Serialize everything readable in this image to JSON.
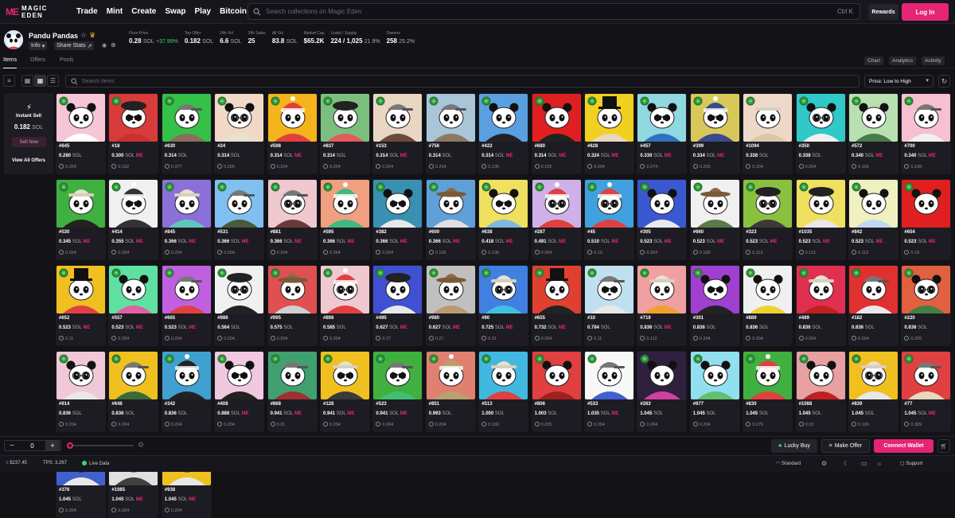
{
  "nav": {
    "brand_mark": "ME",
    "brand_word": "MAGIC EDEN",
    "links": [
      "Trade",
      "Mint",
      "Create",
      "Swap",
      "Play",
      "Bitcoin DeFi"
    ],
    "search_placeholder": "Search collections on Magic Eden",
    "search_shortcut": "Ctrl K",
    "rewards": "Rewards",
    "login": "Log In"
  },
  "collection": {
    "name": "Pandu Pandas",
    "info_label": "Info",
    "share_label": "Share Stats"
  },
  "stats": [
    {
      "label": "Floor Price",
      "value": "0.28",
      "unit": "SOL",
      "change": "+37.99%"
    },
    {
      "label": "Top Offer",
      "value": "0.182",
      "unit": "SOL",
      "change": ""
    },
    {
      "label": "24h Vol",
      "value": "6.6",
      "unit": "SOL",
      "change": ""
    },
    {
      "label": "24h Sales",
      "value": "25",
      "unit": "",
      "change": ""
    },
    {
      "label": "All Vol",
      "value": "83.8",
      "unit": "SOL",
      "change": ""
    },
    {
      "label": "Market Cap",
      "value": "$65.2K",
      "unit": "",
      "change": ""
    },
    {
      "label": "Listed / Supply",
      "value": "224 / 1,025",
      "unit": "21.9%",
      "change": ""
    },
    {
      "label": "Owners",
      "value": "258",
      "unit": "25.2%",
      "change": ""
    }
  ],
  "tabs": [
    "Items",
    "Offers",
    "Pools"
  ],
  "right_tabs": [
    "Chart",
    "Analytics",
    "Activity"
  ],
  "toolbar": {
    "search_placeholder": "Search items",
    "sort_label": "Price: Low to High"
  },
  "instant_sell": {
    "title": "Instant Sell",
    "price": "0.182",
    "unit": "SOL",
    "button": "Sell Now",
    "view_all": "View All Offers"
  },
  "sol_unit": "SOL",
  "me_badge": "ME",
  "items": [
    {
      "id": "#645",
      "price": "0.280",
      "last": "0.204",
      "me": false,
      "bg": "#f6c6d6",
      "hat": "none",
      "shirt": "#ffffff",
      "acc": "none"
    },
    {
      "id": "#18",
      "price": "0.300",
      "last": "0.192",
      "me": true,
      "bg": "#d93a3a",
      "hat": "beret",
      "shirt": "#c93030",
      "acc": "shades"
    },
    {
      "id": "#630",
      "price": "0.314",
      "last": "0.377",
      "me": false,
      "bg": "#35c048",
      "hat": "cap",
      "shirt": "#8a6f5a",
      "acc": "none"
    },
    {
      "id": "#24",
      "price": "0.314",
      "last": "0.205",
      "me": false,
      "bg": "#f2d9c7",
      "hat": "none",
      "shirt": "#e8e0d0",
      "acc": "glasses"
    },
    {
      "id": "#598",
      "price": "0.314",
      "last": "0.204",
      "me": true,
      "bg": "#f6b41c",
      "hat": "beanie",
      "shirt": "#e04040",
      "acc": "none"
    },
    {
      "id": "#837",
      "price": "0.314",
      "last": "0.204",
      "me": false,
      "bg": "#7bbf7f",
      "hat": "beret",
      "shirt": "#e55a5a",
      "acc": "none"
    },
    {
      "id": "#153",
      "price": "0.314",
      "last": "0.204",
      "me": true,
      "bg": "#e9d7c3",
      "hat": "cap",
      "shirt": "#6a4a3a",
      "acc": "none"
    },
    {
      "id": "#756",
      "price": "0.314",
      "last": "0.204",
      "me": false,
      "bg": "#a9c6d9",
      "hat": "cap",
      "shirt": "#8b7a66",
      "acc": "none"
    },
    {
      "id": "#422",
      "price": "0.314",
      "last": "0.105",
      "me": true,
      "bg": "#5aa0e0",
      "hat": "none",
      "shirt": "#222222",
      "acc": "none"
    },
    {
      "id": "#680",
      "price": "0.314",
      "last": "0.105",
      "me": true,
      "bg": "#e02020",
      "hat": "none",
      "shirt": "#222222",
      "acc": "none"
    },
    {
      "id": "#628",
      "price": "0.324",
      "last": "0.204",
      "me": true,
      "bg": "#f0d020",
      "hat": "tophat",
      "shirt": "#e8d8c0",
      "acc": "none"
    },
    {
      "id": "#457",
      "price": "0.330",
      "last": "0.274",
      "me": true,
      "bg": "#8fd8e0",
      "hat": "none",
      "shirt": "#3070c0",
      "acc": "shades"
    },
    {
      "id": "#399",
      "price": "0.334",
      "last": "0.205",
      "me": true,
      "bg": "#d8c85a",
      "hat": "beanie",
      "shirt": "#3a4a8a",
      "acc": "shades"
    },
    {
      "id": "#1094",
      "price": "0.338",
      "last": "0.204",
      "me": false,
      "bg": "#f0d8c8",
      "hat": "bucket",
      "shirt": "#d8c8a8",
      "acc": "none"
    },
    {
      "id": "#350",
      "price": "0.338",
      "last": "0.204",
      "me": false,
      "bg": "#30c8c8",
      "hat": "none",
      "shirt": "#f0f0f0",
      "acc": "glasses"
    },
    {
      "id": "#572",
      "price": "0.340",
      "last": "0.105",
      "me": true,
      "bg": "#b8e0b0",
      "hat": "none",
      "shirt": "#4a7a4a",
      "acc": "none"
    },
    {
      "id": "#700",
      "price": "0.340",
      "last": "0.108",
      "me": true,
      "bg": "#f6c0d0",
      "hat": "cap",
      "shirt": "#f0f0f0",
      "acc": "none"
    },
    {
      "id": "#530",
      "price": "0.345",
      "last": "0.204",
      "me": true,
      "bg": "#40b040",
      "hat": "bucket",
      "shirt": "#222222",
      "acc": "none"
    },
    {
      "id": "#414",
      "price": "0.355",
      "last": "0.204",
      "me": true,
      "bg": "#f0f0f0",
      "hat": "beanie",
      "shirt": "#333333",
      "acc": "shades"
    },
    {
      "id": "#845",
      "price": "0.366",
      "last": "0.204",
      "me": true,
      "bg": "#8a70d8",
      "hat": "bucket",
      "shirt": "#60c8b8",
      "acc": "none"
    },
    {
      "id": "#531",
      "price": "0.366",
      "last": "0.204",
      "me": true,
      "bg": "#80c0f0",
      "hat": "cap",
      "shirt": "#4a5a3a",
      "acc": "none"
    },
    {
      "id": "#881",
      "price": "0.366",
      "last": "0.204",
      "me": true,
      "bg": "#f0c8d0",
      "hat": "cap",
      "shirt": "#6a3a3a",
      "acc": "glasses"
    },
    {
      "id": "#595",
      "price": "0.366",
      "last": "0.264",
      "me": true,
      "bg": "#f0a080",
      "hat": "beanie",
      "shirt": "#40b880",
      "acc": "none"
    },
    {
      "id": "#382",
      "price": "0.366",
      "last": "0.204",
      "me": true,
      "bg": "#3a90b0",
      "hat": "none",
      "shirt": "#e8e8e8",
      "acc": "shades"
    },
    {
      "id": "#600",
      "price": "0.366",
      "last": "0.105",
      "me": true,
      "bg": "#60a0d8",
      "hat": "cowboy",
      "shirt": "#e0e0e0",
      "acc": "none"
    },
    {
      "id": "#638",
      "price": "0.418",
      "last": "0.106",
      "me": true,
      "bg": "#f0e060",
      "hat": "none",
      "shirt": "#80b8e0",
      "acc": "shades"
    },
    {
      "id": "#287",
      "price": "0.491",
      "last": "0.204",
      "me": true,
      "bg": "#d0b0e8",
      "hat": "beanie",
      "shirt": "#e04040",
      "acc": "glasses"
    },
    {
      "id": "#45",
      "price": "0.510",
      "last": "0.13",
      "me": true,
      "bg": "#40a0e0",
      "hat": "beanie",
      "shirt": "#e04040",
      "acc": "glasses"
    },
    {
      "id": "#305",
      "price": "0.523",
      "last": "0.204",
      "me": true,
      "bg": "#3a58d0",
      "hat": "none",
      "shirt": "#e8e8f0",
      "acc": "none"
    },
    {
      "id": "#660",
      "price": "0.523",
      "last": "0.105",
      "me": true,
      "bg": "#f0f0f0",
      "hat": "cowboy",
      "shirt": "#5a7a4a",
      "acc": "none"
    },
    {
      "id": "#323",
      "price": "0.523",
      "last": "0.112",
      "me": true,
      "bg": "#8ac040",
      "hat": "beret",
      "shirt": "#3a3a3a",
      "acc": "glasses"
    },
    {
      "id": "#1035",
      "price": "0.523",
      "last": "0.112",
      "me": true,
      "bg": "#f0e060",
      "hat": "beret",
      "shirt": "#e8e8e8",
      "acc": "none"
    },
    {
      "id": "#842",
      "price": "0.523",
      "last": "0.112",
      "me": true,
      "bg": "#f0f0c0",
      "hat": "none",
      "shirt": "#c0d8f0",
      "acc": "none"
    },
    {
      "id": "#654",
      "price": "0.523",
      "last": "0.19",
      "me": true,
      "bg": "#e02020",
      "hat": "none",
      "shirt": "#e02020",
      "acc": "none"
    },
    {
      "id": "#652",
      "price": "0.523",
      "last": "0.11",
      "me": true,
      "bg": "#f0c020",
      "hat": "tophat",
      "shirt": "#e04040",
      "acc": "none"
    },
    {
      "id": "#557",
      "price": "0.523",
      "last": "0.204",
      "me": true,
      "bg": "#60e0a0",
      "hat": "none",
      "shirt": "#e060a0",
      "acc": "none"
    },
    {
      "id": "#665",
      "price": "0.523",
      "last": "0.204",
      "me": true,
      "bg": "#c060e0",
      "hat": "cap",
      "shirt": "#e04040",
      "acc": "none"
    },
    {
      "id": "#986",
      "price": "0.564",
      "last": "0.204",
      "me": false,
      "bg": "#f0f0f0",
      "hat": "beret",
      "shirt": "#222222",
      "acc": "glasses"
    },
    {
      "id": "#995",
      "price": "0.575",
      "last": "0.204",
      "me": false,
      "bg": "#e05050",
      "hat": "cowboy",
      "shirt": "#d0d0d0",
      "acc": "none"
    },
    {
      "id": "#898",
      "price": "0.585",
      "last": "0.204",
      "me": false,
      "bg": "#f0c8d0",
      "hat": "beanie",
      "shirt": "#e04040",
      "acc": "glasses"
    },
    {
      "id": "#495",
      "price": "0.627",
      "last": "0.27",
      "me": true,
      "bg": "#4050d0",
      "hat": "beret",
      "shirt": "#e8e8e8",
      "acc": "none"
    },
    {
      "id": "#980",
      "price": "0.627",
      "last": "0.27",
      "me": true,
      "bg": "#c0c0c0",
      "hat": "cowboy",
      "shirt": "#b89a70",
      "acc": "none"
    },
    {
      "id": "#90",
      "price": "0.725",
      "last": "0.31",
      "me": true,
      "bg": "#4080e0",
      "hat": "bucket",
      "shirt": "#40c0e0",
      "acc": "glasses"
    },
    {
      "id": "#655",
      "price": "0.732",
      "last": "0.204",
      "me": true,
      "bg": "#e04030",
      "hat": "tophat",
      "shirt": "#222222",
      "acc": "none"
    },
    {
      "id": "#10",
      "price": "0.784",
      "last": "0.11",
      "me": false,
      "bg": "#c0e0f0",
      "hat": "cap",
      "shirt": "#e8e8e8",
      "acc": "shades"
    },
    {
      "id": "#719",
      "price": "0.836",
      "last": "0.112",
      "me": true,
      "bg": "#f0a0a0",
      "hat": "bucket",
      "shirt": "#f0a030",
      "acc": "none"
    },
    {
      "id": "#301",
      "price": "0.836",
      "last": "0.204",
      "me": false,
      "bg": "#a040d0",
      "hat": "none",
      "shirt": "#222222",
      "acc": "shades"
    },
    {
      "id": "#889",
      "price": "0.836",
      "last": "0.204",
      "me": false,
      "bg": "#f0f0f0",
      "hat": "none",
      "shirt": "#f0d030",
      "acc": "none"
    },
    {
      "id": "#489",
      "price": "0.836",
      "last": "0.204",
      "me": false,
      "bg": "#e03050",
      "hat": "bucket",
      "shirt": "#c02020",
      "acc": "none"
    },
    {
      "id": "#182",
      "price": "0.836",
      "last": "0.204",
      "me": false,
      "bg": "#e03030",
      "hat": "cap",
      "shirt": "#e8e8e8",
      "acc": "none"
    },
    {
      "id": "#220",
      "price": "0.836",
      "last": "0.205",
      "me": false,
      "bg": "#e06040",
      "hat": "none",
      "shirt": "#408040",
      "acc": "glasses"
    },
    {
      "id": "#914",
      "price": "0.836",
      "last": "0.204",
      "me": false,
      "bg": "#f0c8d8",
      "hat": "none",
      "shirt": "#e8e8e8",
      "acc": "glasses"
    },
    {
      "id": "#648",
      "price": "0.836",
      "last": "0.204",
      "me": false,
      "bg": "#f0c020",
      "hat": "cap",
      "shirt": "#3a6a3a",
      "acc": "none"
    },
    {
      "id": "#342",
      "price": "0.836",
      "last": "0.204",
      "me": false,
      "bg": "#40a0d0",
      "hat": "beanie",
      "shirt": "#222222",
      "acc": "none"
    },
    {
      "id": "#408",
      "price": "0.888",
      "last": "0.204",
      "me": true,
      "bg": "#f0c8e0",
      "hat": "none",
      "shirt": "#222222",
      "acc": "shades"
    },
    {
      "id": "#868",
      "price": "0.941",
      "last": "0.31",
      "me": true,
      "bg": "#40a070",
      "hat": "cap",
      "shirt": "#a03030",
      "acc": "none"
    },
    {
      "id": "#128",
      "price": "0.941",
      "last": "0.204",
      "me": true,
      "bg": "#f0c020",
      "hat": "bucket",
      "shirt": "#3a3a3a",
      "acc": "shades"
    },
    {
      "id": "#523",
      "price": "0.941",
      "last": "0.204",
      "me": true,
      "bg": "#40b040",
      "hat": "cap",
      "shirt": "#40c070",
      "acc": "shades"
    },
    {
      "id": "#851",
      "price": "0.993",
      "last": "0.204",
      "me": false,
      "bg": "#e08070",
      "hat": "beanie",
      "shirt": "#b8a070",
      "acc": "none"
    },
    {
      "id": "#513",
      "price": "1.000",
      "last": "0.169",
      "me": false,
      "bg": "#40b8e0",
      "hat": "bucket",
      "shirt": "#e04040",
      "acc": "none"
    },
    {
      "id": "#806",
      "price": "1.003",
      "last": "0.205",
      "me": false,
      "bg": "#e04040",
      "hat": "none",
      "shirt": "#a02020",
      "acc": "none"
    },
    {
      "id": "#533",
      "price": "1.035",
      "last": "0.204",
      "me": true,
      "bg": "#f8f8f8",
      "hat": "cap",
      "shirt": "#4060d0",
      "acc": "none"
    },
    {
      "id": "#263",
      "price": "1.045",
      "last": "0.204",
      "me": false,
      "bg": "#302040",
      "hat": "none",
      "shirt": "#d040a0",
      "acc": "none"
    },
    {
      "id": "#677",
      "price": "1.045",
      "last": "0.204",
      "me": false,
      "bg": "#90e0f0",
      "hat": "none",
      "shirt": "#60c070",
      "acc": "none"
    },
    {
      "id": "#830",
      "price": "1.045",
      "last": "0.275",
      "me": false,
      "bg": "#40b040",
      "hat": "beanie",
      "shirt": "#e04040",
      "acc": "none"
    },
    {
      "id": "#1088",
      "price": "1.045",
      "last": "0.15",
      "me": false,
      "bg": "#e8a0a0",
      "hat": "none",
      "shirt": "#c02020",
      "acc": "none"
    },
    {
      "id": "#839",
      "price": "1.045",
      "last": "0.106",
      "me": false,
      "bg": "#f0c020",
      "hat": "bucket",
      "shirt": "#e8e8e8",
      "acc": "glasses"
    },
    {
      "id": "#77",
      "price": "1.045",
      "last": "0.309",
      "me": true,
      "bg": "#e04040",
      "hat": "cap",
      "shirt": "#e8d8c0",
      "acc": "none"
    },
    {
      "id": "#376",
      "price": "1.045",
      "last": "0.204",
      "me": false,
      "bg": "#4060d0",
      "hat": "none",
      "shirt": "#e8e8e8",
      "acc": "none"
    },
    {
      "id": "#1085",
      "price": "1.045",
      "last": "0.204",
      "me": true,
      "bg": "#e0e0e0",
      "hat": "beret",
      "shirt": "#404040",
      "acc": "none"
    },
    {
      "id": "#938",
      "price": "1.045",
      "last": "0.204",
      "me": true,
      "bg": "#f0c020",
      "hat": "none",
      "shirt": "#e8e8e8",
      "acc": "none"
    }
  ],
  "bottom": {
    "qty": "0",
    "minus": "−",
    "plus": "+",
    "lucky_buy": "Lucky Buy",
    "make_offer": "Make Offer",
    "connect_wallet": "Connect Wallet"
  },
  "status": {
    "sol_price": "$237.45",
    "tps_label": "TPS:",
    "tps": "3,267",
    "live": "Live Data",
    "mode": "Standard",
    "support": "Support"
  },
  "colors": {
    "accent": "#e42575",
    "up": "#3ed17d",
    "bg": "#131217"
  }
}
